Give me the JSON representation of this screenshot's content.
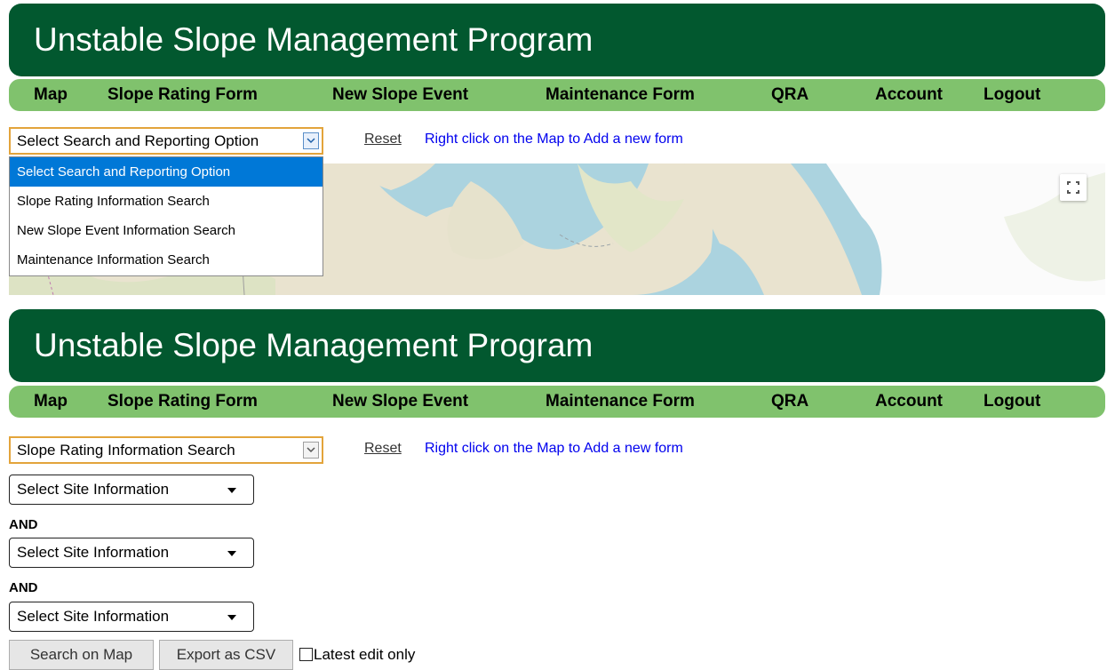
{
  "colors": {
    "header_bg": "#02582f",
    "nav_bg": "#80c26d",
    "select_border": "#e3a43b",
    "link_blue": "#0000ee",
    "option_highlight": "#0078d7"
  },
  "app": {
    "title": "Unstable Slope Management Program"
  },
  "nav": {
    "items": [
      {
        "label": "Map"
      },
      {
        "label": "Slope Rating Form"
      },
      {
        "label": "New Slope Event"
      },
      {
        "label": "Maintenance Form"
      },
      {
        "label": "QRA"
      },
      {
        "label": "Account"
      },
      {
        "label": "Logout"
      }
    ]
  },
  "toolbar": {
    "reset_label": "Reset",
    "hint": "Right click on the Map to Add a new form"
  },
  "panel1": {
    "select_value": "Select Search and Reporting Option",
    "dropdown_options": [
      {
        "label": "Select Search and Reporting Option",
        "selected": true
      },
      {
        "label": "Slope Rating Information Search"
      },
      {
        "label": "New Slope Event Information Search"
      },
      {
        "label": "Maintenance Information Search"
      }
    ]
  },
  "panel2": {
    "select_value": "Slope Rating Information Search",
    "criteria": [
      {
        "value": "Select Site Information"
      },
      {
        "value": "Select Site Information"
      },
      {
        "value": "Select Site Information"
      }
    ],
    "connector": "AND",
    "buttons": {
      "search_label": "Search on Map",
      "export_label": "Export as CSV"
    },
    "checkbox": {
      "label": "Latest edit only",
      "checked": false
    }
  },
  "icons": {
    "select_arrow": "chevron-down-icon",
    "criteria_caret": "caret-down-icon",
    "fullscreen": "fullscreen-icon"
  }
}
